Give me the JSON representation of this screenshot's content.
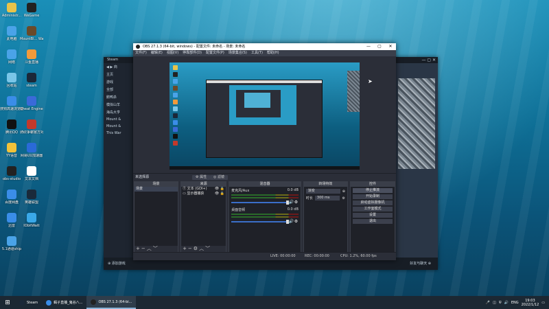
{
  "desktop_icons": [
    {
      "label": "Administr...",
      "color": "#e8c34a"
    },
    {
      "label": "WeGame",
      "color": "#222"
    },
    {
      "label": "此电脑",
      "color": "#4aa3e8"
    },
    {
      "label": "MountBl... Warband",
      "color": "#6a4a2a"
    },
    {
      "label": "网络",
      "color": "#4aa3e8"
    },
    {
      "label": "斗鱼直播",
      "color": "#f29a3a"
    },
    {
      "label": "回收站",
      "color": "#7ac6e8"
    },
    {
      "label": "steam",
      "color": "#1b2838"
    },
    {
      "label": "搜狗高速浏览器",
      "color": "#3a8de8"
    },
    {
      "label": "Cheat Engine",
      "color": "#3a6ad8"
    },
    {
      "label": "腾讯QQ",
      "color": "#111"
    },
    {
      "label": "骑砍争霸官方对战平台",
      "color": "#c2392b"
    },
    {
      "label": "YY语音",
      "color": "#f2c23a"
    },
    {
      "label": "网易UU加速器",
      "color": "#2a6ad8"
    },
    {
      "label": "obs-studio",
      "color": "#222"
    },
    {
      "label": "文本文档",
      "color": "#ffffff"
    },
    {
      "label": "百度网盘",
      "color": "#3a8de8"
    },
    {
      "label": "英雄联盟",
      "color": "#1a2a3a"
    },
    {
      "label": "迅雷",
      "color": "#3a8de8"
    },
    {
      "label": "IObitWatt",
      "color": "#3aa8e8"
    },
    {
      "label": "5.1通道ship",
      "color": "#4aa3e8"
    }
  ],
  "steam": {
    "title": "Steam",
    "nav": "商",
    "sidebar": [
      "主页",
      "游戏",
      "全部",
      "鹅鸭杀",
      "模拟山羊",
      "海岛大亨",
      "Mount &",
      "Mount &",
      "This War"
    ],
    "bottom_left": "添加游戏",
    "bottom_right": "好友与聊天"
  },
  "obs": {
    "title": "OBS 27.1.3 (64-bit, windows) - 配置文件: 未命名 - 场景: 未命名",
    "menu": [
      "文件(F)",
      "编辑(E)",
      "视图(V)",
      "停靠部件(D)",
      "配置文件(P)",
      "场景集合(S)",
      "工具(T)",
      "帮助(H)"
    ],
    "scene_label": "未选择源",
    "btn_props": "属性",
    "btn_filter": "滤镜",
    "docks": {
      "scenes": {
        "title": "场景",
        "items": [
          "场景"
        ]
      },
      "sources": {
        "title": "来源",
        "items": [
          "文本 (GDI+)",
          "显示器捕获"
        ]
      },
      "mixer": {
        "title": "混音器",
        "rows": [
          {
            "name": "麦克风/Aux",
            "db": "0.0 dB"
          },
          {
            "name": "桌面音频",
            "db": "0.0 dB"
          }
        ]
      },
      "transitions": {
        "title": "转场特效",
        "mode": "渐变",
        "duration_label": "时长",
        "duration": "300 ms"
      },
      "controls": {
        "title": "控件",
        "buttons": [
          "停止推流",
          "开始录制",
          "启动虚拟摄像机",
          "工作室模式",
          "设置",
          "退出"
        ]
      }
    },
    "status": {
      "live": "LIVE: 00:00:00",
      "rec": "REC: 00:00:00",
      "cpu": "CPU: 1.2%, 60.00 fps"
    }
  },
  "taskbar": {
    "items": [
      {
        "label": "Steam",
        "color": "#1b2838"
      },
      {
        "label": "蝎子直播_鬼谷八...",
        "color": "#3a8de8"
      },
      {
        "label": "OBS 27.1.3 (64-bi...",
        "color": "#222"
      }
    ],
    "lang": "ENG",
    "time": "19:03",
    "date": "2022/1/12"
  }
}
